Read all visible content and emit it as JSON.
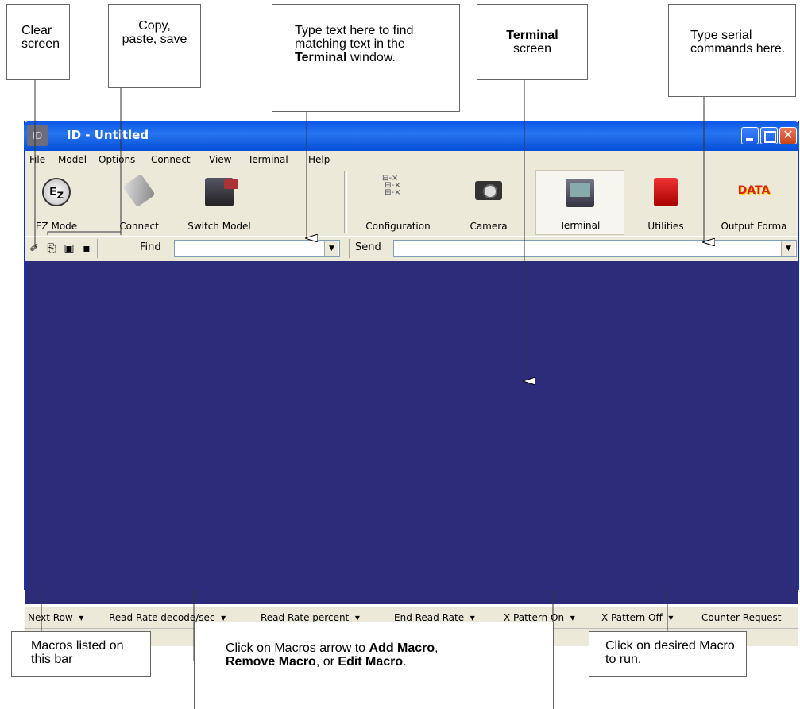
{
  "callouts": {
    "clear": "Clear screen",
    "copy": "Copy, paste, save",
    "find_a": "Type text here to find matching text in the ",
    "find_b": "Terminal",
    "find_c": " window.",
    "terminal_a": "Terminal",
    "terminal_b": "screen",
    "serial": "Type serial commands here.",
    "macros_bar": "Macros listed on this bar",
    "macro_arrow_a": "Click on Macros arrow to ",
    "macro_arrow_b": "Add Macro",
    "macro_arrow_c": ", ",
    "macro_arrow_d": "Remove Macro",
    "macro_arrow_e": ", or ",
    "macro_arrow_f": "Edit Macro",
    "macro_arrow_g": ".",
    "desired": "Click on desired Macro to run."
  },
  "window": {
    "title": "ID - Untitled",
    "icon_label": "ID"
  },
  "menu": [
    "File",
    "Model",
    "Options",
    "Connect",
    "View",
    "Terminal",
    "Help"
  ],
  "toolbar": [
    "EZ Mode",
    "Connect",
    "Switch Model",
    "Configuration",
    "Camera",
    "Terminal",
    "Utilities",
    "Output Forma"
  ],
  "findbar": {
    "find_label": "Find",
    "send_label": "Send"
  },
  "macros": [
    "Next Row",
    "Read Rate decode/sec",
    "Read Rate percent",
    "End Read Rate",
    "X Pattern On",
    "X Pattern Off",
    "Counter Request"
  ],
  "colors": {
    "terminal_bg": "#2C2C7A",
    "titlebar": "#0A58E6",
    "chrome": "#ECE9D8"
  }
}
